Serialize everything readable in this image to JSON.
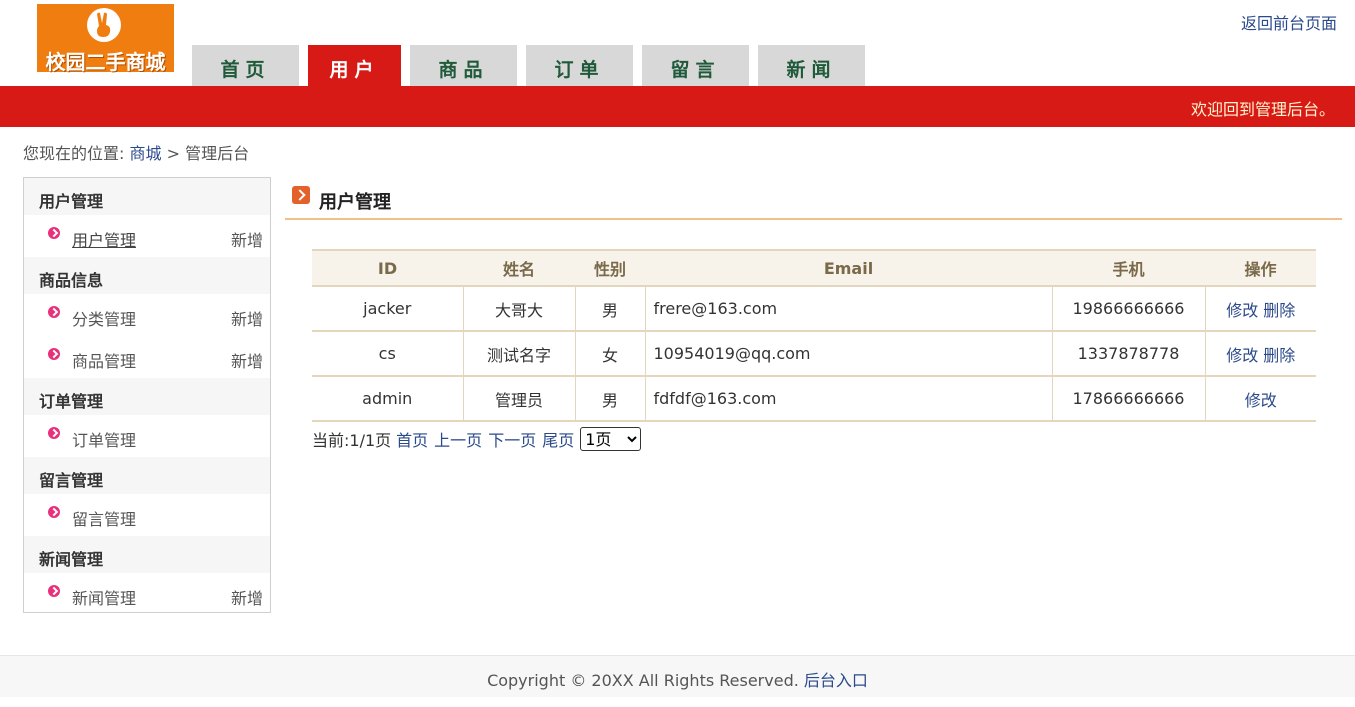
{
  "brand": {
    "logo_text": "校园二手商城",
    "color": "#f07d10"
  },
  "top_link": "返回前台页面",
  "nav": {
    "tabs": [
      {
        "label": "首页",
        "active": false
      },
      {
        "label": "用户",
        "active": true
      },
      {
        "label": "商品",
        "active": false
      },
      {
        "label": "订单",
        "active": false
      },
      {
        "label": "留言",
        "active": false
      },
      {
        "label": "新闻",
        "active": false
      }
    ],
    "accent": "#d81a16"
  },
  "welcome": "欢迎回到管理后台。",
  "breadcrumb": {
    "prefix": "您现在的位置:",
    "home": "商城",
    "separator": ">",
    "current": "管理后台"
  },
  "sidebar": {
    "groups": [
      {
        "title": "用户管理",
        "items": [
          {
            "label": "用户管理",
            "add": "新增"
          }
        ]
      },
      {
        "title": "商品信息",
        "items": [
          {
            "label": "分类管理",
            "add": "新增"
          },
          {
            "label": "商品管理",
            "add": "新增"
          }
        ]
      },
      {
        "title": "订单管理",
        "items": [
          {
            "label": "订单管理",
            "add": ""
          }
        ]
      },
      {
        "title": "留言管理",
        "items": [
          {
            "label": "留言管理",
            "add": ""
          }
        ]
      },
      {
        "title": "新闻管理",
        "items": [
          {
            "label": "新闻管理",
            "add": "新增"
          }
        ]
      }
    ]
  },
  "main": {
    "title": "用户管理",
    "table": {
      "headers": [
        "ID",
        "姓名",
        "性别",
        "Email",
        "手机",
        "操作"
      ],
      "rows": [
        {
          "id": "jacker",
          "name": "大哥大",
          "gender": "男",
          "email": "frere@163.com",
          "phone": "19866666666",
          "edit": "修改",
          "delete": "删除"
        },
        {
          "id": "cs",
          "name": "测试名字",
          "gender": "女",
          "email": "10954019@qq.com",
          "phone": "1337878778",
          "edit": "修改",
          "delete": "删除"
        },
        {
          "id": "admin",
          "name": "管理员",
          "gender": "男",
          "email": "fdfdf@163.com",
          "phone": "17866666666",
          "edit": "修改",
          "delete": ""
        }
      ]
    },
    "pager": {
      "current_text": "当前:1/1页",
      "first": "首页",
      "prev": "上一页",
      "next": "下一页",
      "last": "尾页",
      "select_value": "1页",
      "options": [
        "1页"
      ]
    }
  },
  "footer": {
    "copyright": "Copyright © 20XX All Rights Reserved.",
    "admin_link": "后台入口"
  }
}
